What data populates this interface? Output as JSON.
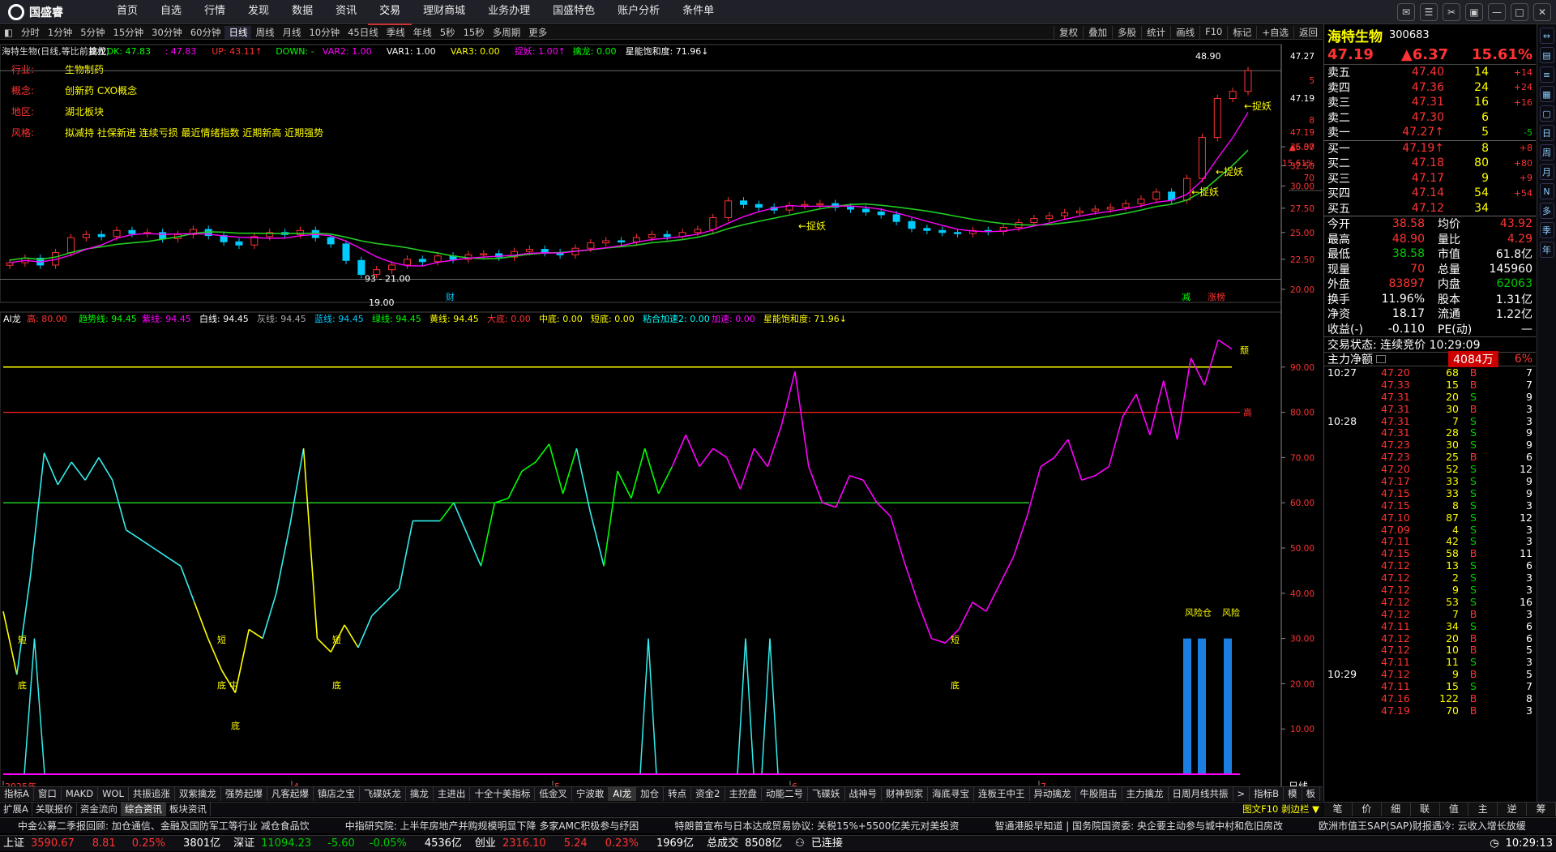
{
  "app": {
    "logo_text": "国盛睿",
    "nav": [
      "首页",
      "自选",
      "行情",
      "发现",
      "数据",
      "资讯",
      "交易",
      "理财商城",
      "业务办理",
      "国盛特色",
      "账户分析",
      "条件单"
    ],
    "active_nav": "交易"
  },
  "toolbar": {
    "periods": [
      "分时",
      "1分钟",
      "5分钟",
      "15分钟",
      "30分钟",
      "60分钟",
      "日线",
      "周线",
      "月线",
      "10分钟",
      "45日线",
      "季线",
      "年线",
      "5秒",
      "15秒",
      "多周期",
      "更多"
    ],
    "active": "日线",
    "right_buttons": [
      "复权",
      "叠加",
      "多股",
      "统计",
      "画线",
      "F10",
      "标记",
      "+自选",
      "返回"
    ]
  },
  "main_chart": {
    "header": [
      {
        "text": "海特生物(日线,等比前复权)",
        "color": "#ddd"
      },
      {
        "text": "擒龙",
        "color": "#fff"
      },
      {
        "text": "DK: 47.83",
        "color": "#0f0"
      },
      {
        "text": ": 47.83",
        "color": "#f0f"
      },
      {
        "text": "UP: 43.11↑",
        "color": "#f33"
      },
      {
        "text": "DOWN: -",
        "color": "#0f0"
      },
      {
        "text": "VAR2: 1.00",
        "color": "#f0f"
      },
      {
        "text": "VAR1: 1.00",
        "color": "#fff"
      },
      {
        "text": "VAR3: 0.00",
        "color": "#ff0"
      },
      {
        "text": "捉妖: 1.00↑",
        "color": "#f0f"
      },
      {
        "text": "擒龙: 0.00",
        "color": "#0f0"
      },
      {
        "text": "星能饱和度: 71.96↓",
        "color": "#fff"
      }
    ],
    "info": [
      {
        "label": "行业:",
        "value": "生物制药"
      },
      {
        "label": "概念:",
        "value": "创新药 CXO概念"
      },
      {
        "label": "地区:",
        "value": "湖北板块"
      },
      {
        "label": "风格:",
        "value": "拟减持 社保新进 连续亏损 最近情绪指数 近期新高 近期强势"
      }
    ],
    "y_labels": [
      "47.27",
      "5",
      "47.19",
      "8",
      "47.19",
      "▲6.37",
      "15.61%",
      "70",
      "35.00",
      "32.50",
      "30.00",
      "27.50",
      "25.00",
      "22.50",
      "20.00"
    ],
    "y_values": [
      35.0,
      32.5,
      30.0,
      27.5,
      25.0,
      22.5,
      20.0
    ],
    "annotations": {
      "high": "48.90",
      "low_left": "19.00",
      "low_mid": "93 - 21.00",
      "fin": "财",
      "zhuoyao": "←捉妖",
      "tag_jian": "减",
      "tag_zhangting": "涨榜"
    },
    "close_series": [
      22.2,
      22.6,
      22.0,
      23.1,
      24.5,
      24.8,
      24.6,
      25.2,
      24.9,
      25.0,
      24.4,
      24.8,
      25.3,
      24.7,
      24.1,
      23.8,
      24.6,
      25.0,
      24.8,
      25.2,
      24.5,
      23.9,
      22.4,
      21.2,
      21.6,
      22.0,
      22.5,
      22.3,
      22.8,
      22.5,
      22.9,
      23.0,
      22.7,
      23.2,
      23.4,
      23.1,
      22.9,
      23.5,
      24.0,
      24.2,
      24.1,
      24.5,
      24.8,
      24.6,
      25.0,
      25.3,
      26.5,
      28.3,
      27.9,
      27.6,
      27.3,
      27.8,
      27.9,
      28.0,
      27.6,
      27.4,
      27.1,
      26.8,
      26.1,
      25.4,
      25.2,
      25.0,
      24.9,
      25.2,
      25.1,
      25.5,
      26.0,
      26.4,
      26.7,
      27.0,
      27.2,
      27.4,
      27.6,
      28.0,
      28.5,
      29.3,
      28.4,
      30.9,
      36.3,
      42.3,
      43.5,
      47.2
    ]
  },
  "indicator": {
    "header": [
      {
        "text": "AI龙",
        "color": "#fff"
      },
      {
        "text": "高: 80.00",
        "color": "#f33"
      },
      {
        "text": "趋势线: 94.45",
        "color": "#0f0"
      },
      {
        "text": "紫线: 94.45",
        "color": "#f0f"
      },
      {
        "text": "白线: 94.45",
        "color": "#fff"
      },
      {
        "text": "灰线: 94.45",
        "color": "#aaa"
      },
      {
        "text": "蓝线: 94.45",
        "color": "#0cf"
      },
      {
        "text": "绿线: 94.45",
        "color": "#0f0"
      },
      {
        "text": "黄线: 94.45",
        "color": "#ff0"
      },
      {
        "text": "大底: 0.00",
        "color": "#f33"
      },
      {
        "text": "中底: 0.00",
        "color": "#ff0"
      },
      {
        "text": "短底: 0.00",
        "color": "#ff0"
      },
      {
        "text": "粘合加速2: 0.00",
        "color": "#0ff"
      },
      {
        "text": "加速: 0.00",
        "color": "#f0f"
      },
      {
        "text": "星能饱和度: 71.96↓",
        "color": "#ff0"
      }
    ],
    "y_labels": [
      "90.00",
      "80.00",
      "70.00",
      "60.00",
      "50.00",
      "40.00",
      "30.00",
      "20.00",
      "10.00"
    ],
    "y_values": [
      90,
      80,
      70,
      60,
      50,
      40,
      30,
      20,
      10
    ],
    "line_values": [
      36,
      22,
      44,
      71,
      64,
      69,
      65,
      70,
      65,
      54,
      52,
      50,
      48,
      46,
      38,
      30,
      23,
      18,
      32,
      30,
      40,
      55,
      72,
      30,
      27,
      33,
      28,
      35,
      38,
      41,
      56,
      56,
      56,
      60,
      53,
      46,
      60,
      61,
      67,
      69,
      73,
      62,
      72,
      58,
      46,
      67,
      61,
      72,
      62,
      68,
      75,
      68,
      72,
      70,
      63,
      72,
      68,
      77,
      89,
      68,
      60,
      59,
      66,
      65,
      60,
      57,
      47,
      38,
      30,
      29,
      32,
      38,
      36,
      42,
      48,
      57,
      68,
      70,
      74,
      65,
      66,
      68,
      79,
      84,
      75,
      87,
      74,
      92,
      86,
      96,
      94
    ],
    "labels": {
      "di": "底",
      "duan": "短",
      "zhong": "中",
      "feng": "风险",
      "fengxian": "风险仓",
      "gao": "高",
      "tui": "颓"
    },
    "x_labels": [
      "2025年",
      "4",
      "5",
      "6",
      "7"
    ]
  },
  "tabs_row1": [
    "指标A",
    "窗口",
    "MAKD",
    "WOL",
    "共振追涨",
    "双紫擒龙",
    "强势起爆",
    "凡客起爆",
    "镇店之宝",
    "飞碟妖龙",
    "擒龙",
    "主进出",
    "十全十美指标",
    "低金叉",
    "宁波敢",
    "AI龙",
    "加仓",
    "转点",
    "资金2",
    "主控盘",
    "动能二号",
    "飞碟妖",
    "战神号",
    "财神到家",
    "海底寻宝",
    "连板王中王",
    "异动擒龙",
    "牛股阻击",
    "主力擒龙",
    "日周月线共振",
    ">",
    "指标B",
    "模",
    "板",
    "+",
    "-"
  ],
  "active_tab1": "AI龙",
  "tabs_row2": [
    "扩展A",
    "关联报价",
    "资金流向",
    "综合资讯",
    "板块资讯"
  ],
  "active_tab2": "综合资讯",
  "right_panel": {
    "name": "海特生物",
    "code": "300683",
    "price": "47.19",
    "change": "▲6.37",
    "pct": "15.61%",
    "asks": [
      {
        "label": "卖五",
        "price": "47.40",
        "vol": "14",
        "chg": "+14"
      },
      {
        "label": "卖四",
        "price": "47.36",
        "vol": "24",
        "chg": "+24"
      },
      {
        "label": "卖三",
        "price": "47.31",
        "vol": "16",
        "chg": "+16"
      },
      {
        "label": "卖二",
        "price": "47.30",
        "vol": "6",
        "chg": ""
      },
      {
        "label": "卖一",
        "price": "47.27↑",
        "vol": "5",
        "chg": "-5"
      }
    ],
    "bids": [
      {
        "label": "买一",
        "price": "47.19↑",
        "vol": "8",
        "chg": "+8"
      },
      {
        "label": "买二",
        "price": "47.18",
        "vol": "80",
        "chg": "+80"
      },
      {
        "label": "买三",
        "price": "47.17",
        "vol": "9",
        "chg": "+9"
      },
      {
        "label": "买四",
        "price": "47.14",
        "vol": "54",
        "chg": "+54"
      },
      {
        "label": "买五",
        "price": "47.12",
        "vol": "34",
        "chg": ""
      }
    ],
    "stats": [
      [
        "今开",
        "38.58",
        "均价",
        "43.92"
      ],
      [
        "最高",
        "48.90",
        "量比",
        "4.29"
      ],
      [
        "最低",
        "38.58",
        "市值",
        "61.8亿"
      ],
      [
        "现量",
        "70",
        "总量",
        "145960"
      ],
      [
        "外盘",
        "83897",
        "内盘",
        "62063"
      ],
      [
        "换手",
        "11.96%",
        "股本",
        "1.31亿"
      ],
      [
        "净资",
        "18.17",
        "流通",
        "1.22亿"
      ],
      [
        "收益(-)",
        "-0.110",
        "PE(动)",
        "—"
      ]
    ],
    "trade_status": "交易状态: 连续竞价 10:29:09",
    "main_flow_label": "主力净额",
    "main_flow_value": "4084万",
    "main_flow_pct": "6%",
    "ticks": [
      [
        "10:27",
        "47.20",
        "68",
        "B",
        "7"
      ],
      [
        "",
        "47.33",
        "15",
        "B",
        "7"
      ],
      [
        "",
        "47.31",
        "20",
        "S",
        "9"
      ],
      [
        "",
        "47.31",
        "30",
        "B",
        "3"
      ],
      [
        "10:28",
        "47.31",
        "7",
        "S",
        "3"
      ],
      [
        "",
        "47.31",
        "28",
        "S",
        "9"
      ],
      [
        "",
        "47.23",
        "30",
        "S",
        "9"
      ],
      [
        "",
        "47.23",
        "25",
        "B",
        "6"
      ],
      [
        "",
        "47.20",
        "52",
        "S",
        "12"
      ],
      [
        "",
        "47.17",
        "33",
        "S",
        "9"
      ],
      [
        "",
        "47.15",
        "33",
        "S",
        "9"
      ],
      [
        "",
        "47.15",
        "8",
        "S",
        "3"
      ],
      [
        "",
        "47.10",
        "87",
        "S",
        "12"
      ],
      [
        "",
        "47.09",
        "4",
        "S",
        "3"
      ],
      [
        "",
        "47.11",
        "42",
        "S",
        "3"
      ],
      [
        "",
        "47.15",
        "58",
        "B",
        "11"
      ],
      [
        "",
        "47.12",
        "13",
        "S",
        "6"
      ],
      [
        "",
        "47.12",
        "2",
        "S",
        "3"
      ],
      [
        "",
        "47.12",
        "9",
        "S",
        "3"
      ],
      [
        "",
        "47.12",
        "53",
        "S",
        "16"
      ],
      [
        "",
        "47.12",
        "7",
        "B",
        "3"
      ],
      [
        "",
        "47.11",
        "34",
        "S",
        "6"
      ],
      [
        "",
        "47.12",
        "20",
        "B",
        "6"
      ],
      [
        "",
        "47.12",
        "10",
        "B",
        "5"
      ],
      [
        "",
        "47.11",
        "11",
        "S",
        "3"
      ],
      [
        "10:29",
        "47.12",
        "9",
        "B",
        "5"
      ],
      [
        "",
        "47.11",
        "15",
        "S",
        "7"
      ],
      [
        "",
        "47.16",
        "122",
        "B",
        "8"
      ],
      [
        "",
        "47.19",
        "70",
        "B",
        "3"
      ]
    ],
    "bottom_tabs": [
      "笔",
      "价",
      "细",
      "联",
      "值",
      "主",
      "逆",
      "筹"
    ]
  },
  "sidebar_icons": [
    "arrow-icon",
    "chart-icon",
    "list-icon",
    "grid-icon",
    "window-icon",
    "日",
    "周",
    "月",
    "N",
    "多",
    "季",
    "年"
  ],
  "news": [
    "中金公募二季报回顾: 加仓通信、金融及国防军工等行业 减仓食品饮",
    "中指研究院: 上半年房地产并购规模明显下降 多家AMC积极参与纾困",
    "特朗普宣布与日本达成贸易协议: 关税15%+5500亿美元对美投资",
    "智通港股早知道 | 国务院国资委: 央企要主动参与城中村和危旧房改",
    "欧洲市值王SAP(SAP)财报遇冷: 云收入增长放缓"
  ],
  "status_bar": {
    "sh_label": "上证",
    "sh_val": "3590.67",
    "sh_chg": "8.81",
    "sh_pct": "0.25%",
    "sh_amt": "3801亿",
    "sz_label": "深证",
    "sz_val": "11094.23",
    "sz_chg": "-5.60",
    "sz_pct": "-0.05%",
    "sz_amt": "4536亿",
    "cy_label": "创业",
    "cy_val": "2316.10",
    "cy_chg": "5.24",
    "cy_pct": "0.23%",
    "cy_amt": "1969亿",
    "total_label": "总成交",
    "total": "8508亿",
    "conn": "已连接",
    "time": "10:29:13"
  },
  "x_axis_right": "日线",
  "chart_label_right": "图文F10 剥边栏 ▼"
}
